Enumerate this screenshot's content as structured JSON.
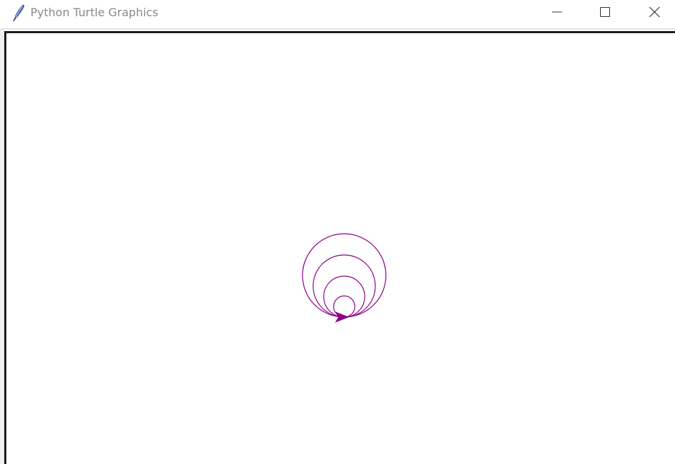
{
  "window": {
    "title": "Python Turtle Graphics",
    "icon": "feather-icon"
  },
  "caption_buttons": {
    "minimize_icon": "minimize-icon",
    "maximize_icon": "maximize-icon",
    "close_icon": "close-icon"
  },
  "drawing": {
    "pen_color": "#8b008b",
    "shape": "arrow",
    "circle_radii": [
      15,
      29,
      44,
      59
    ]
  }
}
